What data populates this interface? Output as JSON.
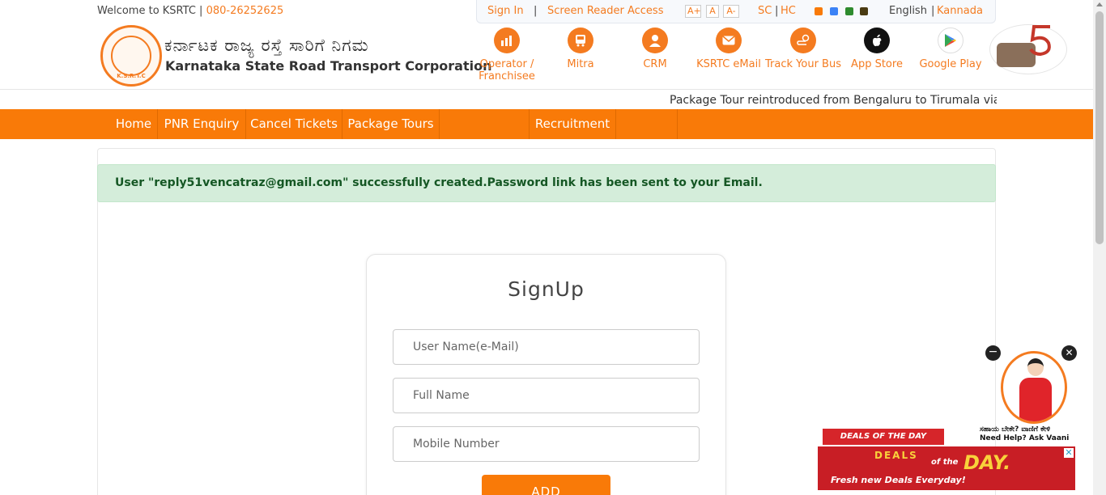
{
  "topbar": {
    "welcome_text": "Welcome to KSRTC |",
    "phone": "080-26252625",
    "sign_in": "Sign In",
    "separator": "|",
    "screen_reader": "Screen Reader Access",
    "font_increase": "A+",
    "font_normal": "A",
    "font_decrease": "A-",
    "sc": "SC",
    "pipe2": "|",
    "hc": "HC",
    "theme_colors": [
      "#f97a08",
      "#3b82f6",
      "#2e8b2e",
      "#4a3b12"
    ],
    "english": "English",
    "pipe3": "|",
    "kannada": "Kannada"
  },
  "header": {
    "logo_text": "K.S.R.T.C",
    "brand_kannada": "ಕರ್ನಾಟಕ ರಾಜ್ಯ ರಸ್ತೆ ಸಾರಿಗೆ ನಿಗಮ",
    "brand_english": "Karnataka State Road Transport Corporation",
    "icons": [
      {
        "label": "Operator / Franchisee",
        "icon": "operator-chart-icon"
      },
      {
        "label": "Mitra",
        "icon": "bus-icon"
      },
      {
        "label": "CRM",
        "icon": "person-icon"
      },
      {
        "label": "KSRTC eMail",
        "icon": "email-icon"
      },
      {
        "label": "Track Your Bus",
        "icon": "location-track-icon"
      },
      {
        "label": "App Store",
        "icon": "apple-icon"
      },
      {
        "label": "Google Play",
        "icon": "google-play-icon"
      }
    ]
  },
  "ticker": {
    "text": "Package Tour reintroduced from Bengaluru to Tirumala via"
  },
  "nav": {
    "items": [
      "Home",
      "PNR Enquiry",
      "Cancel Tickets",
      "Package Tours",
      "",
      "Recruitment",
      ""
    ]
  },
  "alert": {
    "message": "User \"reply51vencatraz@gmail.com\" successfully created.Password link has been sent to your Email."
  },
  "signup": {
    "title": "SignUp",
    "username_placeholder": "User Name(e-Mail)",
    "fullname_placeholder": "Full Name",
    "mobile_placeholder": "Mobile Number",
    "add_label": "ADD"
  },
  "chat": {
    "minimize": "−",
    "close": "✕",
    "help_kannada": "ಸಹಾಯ ಬೇಕೇ? ವಾಣಿಗೆ ಕೇಳಿ",
    "help_english": "Need Help? Ask Vaani"
  },
  "ad": {
    "ribbon": "DEALS OF THE DAY",
    "deals": "DEALS",
    "of_the": "of the",
    "day": "DAY.",
    "tagline": "Fresh new Deals Everyday!",
    "close": "✕"
  }
}
